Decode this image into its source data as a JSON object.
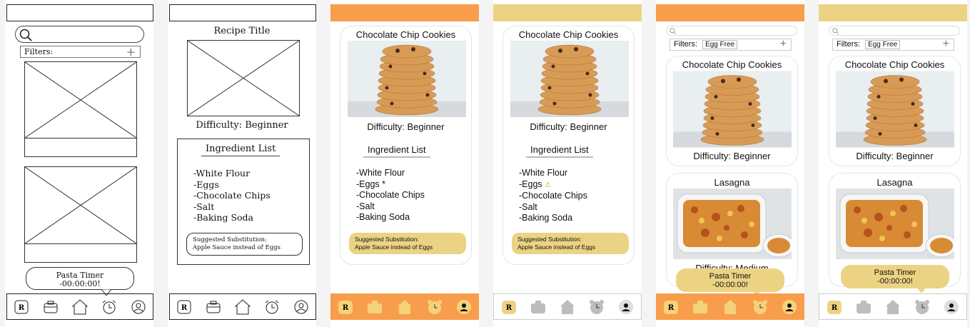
{
  "wireframe_list": {
    "filters_label": "Filters:",
    "timer_title": "Pasta Timer",
    "timer_value": "-00:00:00!"
  },
  "wireframe_detail": {
    "recipe_title": "Recipe Title",
    "difficulty": "Difficulty: Beginner",
    "ingredient_heading": "Ingredient List",
    "ingredients": [
      "-White Flour",
      "-Eggs",
      "-Chocolate Chips",
      "-Salt",
      "-Baking Soda"
    ],
    "substitution_line1": "Suggested Substitution:",
    "substitution_line2": "Apple Sauce instead of Eggs"
  },
  "detail_orange": {
    "recipe_title": "Chocolate Chip Cookies",
    "difficulty": "Difficulty: Beginner",
    "ingredient_heading": "Ingredient List",
    "ingredients": [
      "-White Flour",
      "-Eggs *",
      "-Chocolate Chips",
      "-Salt",
      "-Baking Soda"
    ],
    "substitution_line1": "Suggested Substitution:",
    "substitution_line2": "Apple Sauce instead of Eggs"
  },
  "detail_yellow": {
    "recipe_title": "Chocolate Chip Cookies",
    "difficulty": "Difficulty: Beginner",
    "ingredient_heading": "Ingredient List",
    "ingredients": [
      "-White Flour",
      "-Eggs",
      "-Chocolate Chips",
      "-Salt",
      "-Baking Soda"
    ],
    "warning_icon": "⚠",
    "substitution_line1": "Suggested Substitution:",
    "substitution_line2": "Apple Sauce instead of Eggs"
  },
  "list_orange": {
    "filters_label": "Filters:",
    "filter_tag": "Egg Free",
    "card1_title": "Chocolate Chip Cookies",
    "card1_difficulty": "Difficulty: Beginner",
    "card2_title": "Lasagna",
    "card2_difficulty": "Difficulty: Medium",
    "timer_title": "Pasta Timer",
    "timer_value": "-00:00:00!"
  },
  "list_yellow": {
    "filters_label": "Filters:",
    "filter_tag": "Egg Free",
    "card1_title": "Chocolate Chip Cookies",
    "card1_difficulty": "Difficulty: Beginner",
    "card2_title": "Lasagna",
    "timer_title": "Pasta Timer",
    "timer_value": "-00:00:00!"
  },
  "nav": {
    "recipes_letter": "R"
  },
  "icons": [
    "search-icon",
    "plus-icon",
    "recipe-book-icon",
    "pantry-box-icon",
    "home-icon",
    "alarm-clock-icon",
    "profile-icon",
    "warning-icon"
  ],
  "colors": {
    "orange": "#f89d4c",
    "yellow": "#ecd384"
  }
}
